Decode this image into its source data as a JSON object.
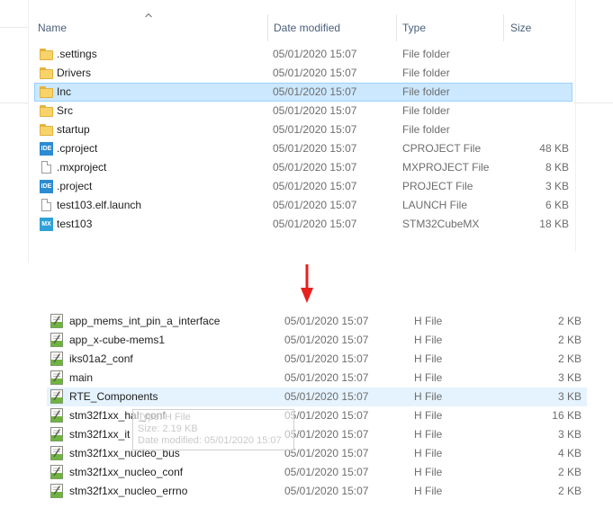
{
  "columns": {
    "name": "Name",
    "date": "Date modified",
    "type": "Type",
    "size": "Size"
  },
  "top_files": [
    {
      "name": ".settings",
      "date": "05/01/2020 15:07",
      "type": "File folder",
      "size": "",
      "icon": "folder-icon"
    },
    {
      "name": "Drivers",
      "date": "05/01/2020 15:07",
      "type": "File folder",
      "size": "",
      "icon": "folder-icon"
    },
    {
      "name": "Inc",
      "date": "05/01/2020 15:07",
      "type": "File folder",
      "size": "",
      "icon": "folder-icon",
      "selected": true
    },
    {
      "name": "Src",
      "date": "05/01/2020 15:07",
      "type": "File folder",
      "size": "",
      "icon": "folder-icon"
    },
    {
      "name": "startup",
      "date": "05/01/2020 15:07",
      "type": "File folder",
      "size": "",
      "icon": "folder-icon"
    },
    {
      "name": ".cproject",
      "date": "05/01/2020 15:07",
      "type": "CPROJECT File",
      "size": "48 KB",
      "icon": "ide-file-icon"
    },
    {
      "name": ".mxproject",
      "date": "05/01/2020 15:07",
      "type": "MXPROJECT File",
      "size": "8 KB",
      "icon": "document-icon"
    },
    {
      "name": ".project",
      "date": "05/01/2020 15:07",
      "type": "PROJECT File",
      "size": "3 KB",
      "icon": "ide-file-icon"
    },
    {
      "name": "test103.elf.launch",
      "date": "05/01/2020 15:07",
      "type": "LAUNCH File",
      "size": "6 KB",
      "icon": "document-icon"
    },
    {
      "name": "test103",
      "date": "05/01/2020 15:07",
      "type": "STM32CubeMX",
      "size": "18 KB",
      "icon": "stm32cubemx-icon"
    }
  ],
  "ide_badge": "IDE",
  "mx_badge": "MX",
  "bottom_files": [
    {
      "name": "app_mems_int_pin_a_interface",
      "date": "05/01/2020 15:07",
      "type": "H File",
      "size": "2 KB"
    },
    {
      "name": "app_x-cube-mems1",
      "date": "05/01/2020 15:07",
      "type": "H File",
      "size": "2 KB"
    },
    {
      "name": "iks01a2_conf",
      "date": "05/01/2020 15:07",
      "type": "H File",
      "size": "2 KB"
    },
    {
      "name": "main",
      "date": "05/01/2020 15:07",
      "type": "H File",
      "size": "3 KB"
    },
    {
      "name": "RTE_Components",
      "date": "05/01/2020 15:07",
      "type": "H File",
      "size": "3 KB",
      "hover": true
    },
    {
      "name": "stm32f1xx_hal_conf",
      "date": "05/01/2020 15:07",
      "type": "H File",
      "size": "16 KB"
    },
    {
      "name": "stm32f1xx_it",
      "date": "05/01/2020 15:07",
      "type": "H File",
      "size": "3 KB"
    },
    {
      "name": "stm32f1xx_nucleo_bus",
      "date": "05/01/2020 15:07",
      "type": "H File",
      "size": "4 KB"
    },
    {
      "name": "stm32f1xx_nucleo_conf",
      "date": "05/01/2020 15:07",
      "type": "H File",
      "size": "2 KB"
    },
    {
      "name": "stm32f1xx_nucleo_errno",
      "date": "05/01/2020 15:07",
      "type": "H File",
      "size": "2 KB"
    }
  ],
  "tooltip": {
    "type_line": "Type: H File",
    "size_line": "Size: 2.19 KB",
    "date_line": "Date modified: 05/01/2020 15:07"
  },
  "colors": {
    "selection": "#cce8ff",
    "hover": "#e5f3ff",
    "arrow": "#e8201e",
    "header_text": "#4c607a"
  }
}
